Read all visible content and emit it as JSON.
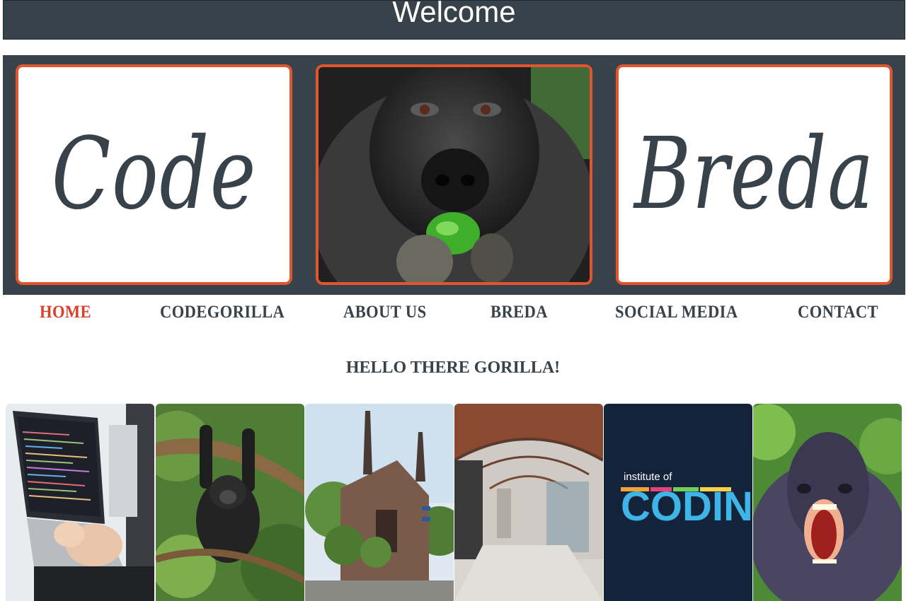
{
  "header": {
    "title": "Welcome"
  },
  "banner": {
    "left_word": "Code",
    "right_word": "Breda",
    "center_image": "gorilla-eating-pepper"
  },
  "nav": {
    "items": [
      {
        "label": "HOME",
        "active": true
      },
      {
        "label": "CODEGORILLA",
        "active": false
      },
      {
        "label": "ABOUT US",
        "active": false
      },
      {
        "label": "BREDA",
        "active": false
      },
      {
        "label": "SOCIAL MEDIA",
        "active": false
      },
      {
        "label": "CONTACT",
        "active": false
      }
    ]
  },
  "main": {
    "heading": "HELLO THERE GORILLA!"
  },
  "gallery": {
    "photos": [
      {
        "subject": "laptop-coding"
      },
      {
        "subject": "baby-gorilla-on-branch"
      },
      {
        "subject": "breda-church"
      },
      {
        "subject": "arched-hallway"
      },
      {
        "subject": "institute-of-coding-logo",
        "logo_small": "institute of",
        "logo_big": "CODING"
      },
      {
        "subject": "roaring-gorilla"
      }
    ]
  },
  "colors": {
    "dark": "#37424a",
    "accent": "#e0542e",
    "active_nav": "#d9402a"
  }
}
